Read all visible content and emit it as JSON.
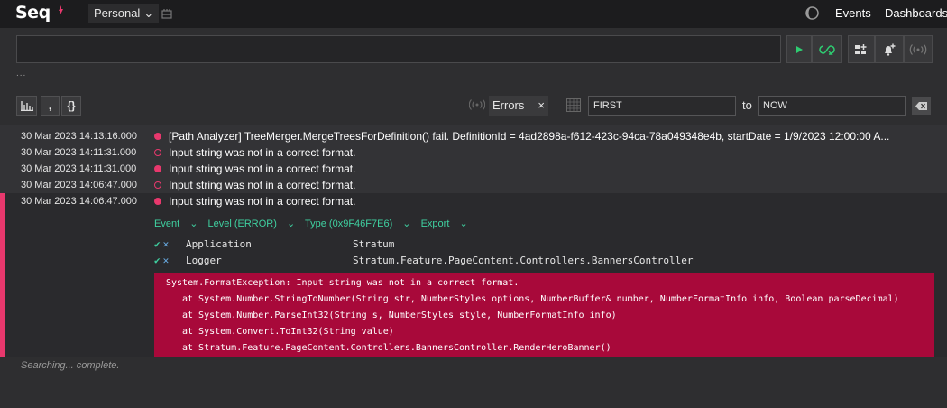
{
  "app": {
    "logo_text": "Seq"
  },
  "header": {
    "workspace_label": "Personal",
    "nav": [
      "Events",
      "Dashboards"
    ]
  },
  "search": {
    "placeholder": "",
    "more": "..."
  },
  "toolbar": {
    "signal_name": "Errors",
    "remove_signal": "×",
    "range_from_placeholder": "FIRST",
    "range_to_label": "to",
    "range_to_placeholder": "NOW",
    "comma_label": ",",
    "json_label": "{}"
  },
  "events": [
    {
      "timestamp": "30 Mar 2023  14:13:16.000",
      "message": "[Path Analyzer] TreeMerger.MergeTreesForDefinition() fail. DefinitionId = 4ad2898a-f612-423c-94ca-78a049348e4b, startDate = 1/9/2023 12:00:00 A...",
      "level_marker": "filled"
    },
    {
      "timestamp": "30 Mar 2023  14:11:31.000",
      "message": "Input string was not in a correct format.",
      "level_marker": "hollow"
    },
    {
      "timestamp": "30 Mar 2023  14:11:31.000",
      "message": "Input string was not in a correct format.",
      "level_marker": "filled"
    },
    {
      "timestamp": "30 Mar 2023  14:06:47.000",
      "message": "Input string was not in a correct format.",
      "level_marker": "hollow"
    },
    {
      "timestamp": "30 Mar 2023  14:06:47.000",
      "message": "Input string was not in a correct format.",
      "level_marker": "filled"
    }
  ],
  "expanded_event": {
    "actions": [
      "Event",
      "Level (ERROR)",
      "Type (0x9F46F7E6)",
      "Export"
    ],
    "properties": [
      {
        "name": "Application",
        "value": "Stratum"
      },
      {
        "name": "Logger",
        "value": "Stratum.Feature.PageContent.Controllers.BannersController"
      }
    ],
    "exception": [
      "System.FormatException: Input string was not in a correct format.",
      "at System.Number.StringToNumber(String str, NumberStyles options, NumberBuffer& number, NumberFormatInfo info, Boolean parseDecimal)",
      "at System.Number.ParseInt32(String s, NumberStyles style, NumberFormatInfo info)",
      "at System.Convert.ToInt32(String value)",
      "at Stratum.Feature.PageContent.Controllers.BannersController.RenderHeroBanner()"
    ]
  },
  "status": "Searching... complete.",
  "colors": {
    "accent": "#e8386d",
    "exception_bg": "#a8093a",
    "action_green": "#3fd0a0",
    "run_green": "#2ecc71"
  }
}
